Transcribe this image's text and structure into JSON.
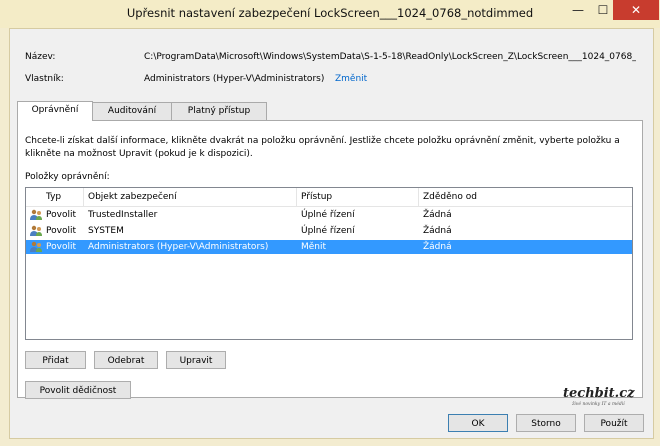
{
  "window": {
    "title": "Upřesnit nastavení zabezpečení LockScreen___1024_0768_notdimmed",
    "min_symbol": "—",
    "max_symbol": "☐",
    "close_symbol": "✕"
  },
  "info": {
    "name_label": "Název:",
    "name_value": "C:\\ProgramData\\Microsoft\\Windows\\SystemData\\S-1-5-18\\ReadOnly\\LockScreen_Z\\LockScreen___1024_0768_",
    "owner_label": "Vlastník:",
    "owner_value": "Administrators (Hyper-V\\Administrators)",
    "change_link": "Změnit"
  },
  "tabs": [
    {
      "label": "Oprávnění",
      "active": true
    },
    {
      "label": "Auditování",
      "active": false
    },
    {
      "label": "Platný přístup",
      "active": false
    }
  ],
  "panel": {
    "description_line1": "Chcete-li získat další informace, klikněte dvakrát na položku oprávnění. Jestliže chcete položku oprávnění změnit, vyberte položku a",
    "description_line2": "klikněte na možnost Upravit (pokud je k dispozici).",
    "entries_label": "Položky oprávnění:"
  },
  "table": {
    "columns": [
      "Typ",
      "Objekt zabezpečení",
      "Přístup",
      "Zděděno od"
    ],
    "rows": [
      {
        "type": "Povolit",
        "principal": "TrustedInstaller",
        "access": "Úplné řízení",
        "inherited": "Žádná",
        "selected": false,
        "icon": "users-icon"
      },
      {
        "type": "Povolit",
        "principal": "SYSTEM",
        "access": "Úplné řízení",
        "inherited": "Žádná",
        "selected": false,
        "icon": "users-icon"
      },
      {
        "type": "Povolit",
        "principal": "Administrators (Hyper-V\\Administrators)",
        "access": "Měnit",
        "inherited": "Žádná",
        "selected": true,
        "icon": "users-icon"
      }
    ]
  },
  "buttons": {
    "add": "Přidat",
    "remove": "Odebrat",
    "edit": "Upravit",
    "enable_inheritance": "Povolit dědičnost",
    "ok": "OK",
    "cancel": "Storno",
    "apply": "Použít"
  },
  "watermark": {
    "logo": "techbit.cz",
    "tagline": "živé novinky IT a médií"
  },
  "colors": {
    "selection": "#3399ff",
    "link": "#0066cc",
    "close_button": "#c83c2e",
    "window_frame": "#f3ecd0"
  }
}
